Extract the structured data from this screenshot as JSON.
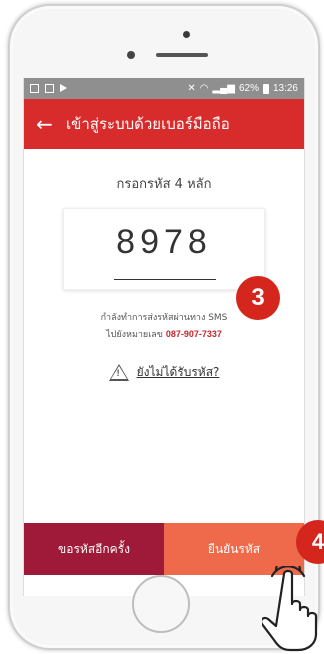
{
  "statusbar": {
    "battery": "62%",
    "time": "13:26"
  },
  "appbar": {
    "back_icon": "←",
    "title": "เข้าสู่ระบบด้วยเบอร์มือถือ"
  },
  "content": {
    "prompt": "กรอกรหัส 4 หลัก",
    "code": "8978",
    "sms_line1": "กำลังทำการส่งรหัสผ่านทาง SMS",
    "sms_line2_prefix": "ไปยังหมายเลข",
    "phone_number": "087-907-7337",
    "warning_icon": "!",
    "resend_link": "ยังไม่ได้รับรหัส?"
  },
  "buttons": {
    "resend": "ขอรหัสอีกครั้ง",
    "confirm": "ยืนยันรหัส"
  },
  "annotations": {
    "step3": "3",
    "step4": "4"
  },
  "colors": {
    "appbar": "#d82c2c",
    "resend_button": "#9e1a38",
    "confirm_button": "#ef6a4a",
    "badge": "#d5261d"
  }
}
